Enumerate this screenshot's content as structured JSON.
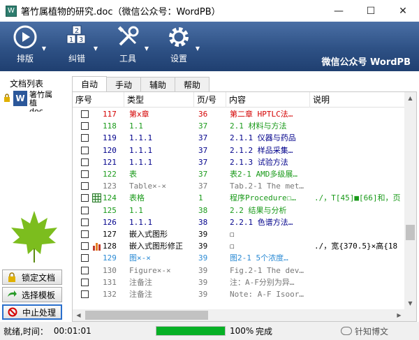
{
  "window": {
    "title": "箸竹属植物的研究.doc（微信公众号：WordPB）",
    "minimize": "—",
    "maximize": "☐",
    "close": "✕"
  },
  "toolbar": {
    "items": [
      {
        "label": "排版",
        "icon": "play-icon"
      },
      {
        "label": "纠错",
        "icon": "blocks-icon"
      },
      {
        "label": "工具",
        "icon": "tools-icon"
      },
      {
        "label": "设置",
        "icon": "gear-icon"
      }
    ],
    "brand": "微信公众号 WordPB"
  },
  "sidebar": {
    "title": "文档列表",
    "doc_name": "箸竹属植物的研究.doc",
    "doc_name_line1": "箸竹属植",
    "doc_name_line2": "doc",
    "buttons": [
      {
        "label": "锁定文档",
        "icon": "lock-icon"
      },
      {
        "label": "选择模板",
        "icon": "arrow-icon"
      },
      {
        "label": "中止处理",
        "icon": "stop-icon"
      }
    ]
  },
  "tabs": [
    "自动",
    "手动",
    "辅助",
    "帮助"
  ],
  "table": {
    "headers": [
      "序号",
      "类型",
      "页/号",
      "内容",
      "说明"
    ],
    "rows": [
      {
        "num": "117",
        "type": "第x章",
        "page": "36",
        "content": "第二章  HPTLC法…",
        "note": "",
        "color": "#d40000",
        "icon": ""
      },
      {
        "num": "118",
        "type": "1.1",
        "page": "37",
        "content": "2.1 材料与方法",
        "note": "",
        "color": "#1a9a1a",
        "icon": ""
      },
      {
        "num": "119",
        "type": "1.1.1",
        "page": "37",
        "content": "2.1.1 仪器与药品",
        "note": "",
        "color": "#00008b",
        "icon": ""
      },
      {
        "num": "120",
        "type": "1.1.1",
        "page": "37",
        "content": "2.1.2 样品采集…",
        "note": "",
        "color": "#00008b",
        "icon": ""
      },
      {
        "num": "121",
        "type": "1.1.1",
        "page": "37",
        "content": "2.1.3 试验方法",
        "note": "",
        "color": "#00008b",
        "icon": ""
      },
      {
        "num": "122",
        "type": "表",
        "page": "37",
        "content": "表2-1 AMD多级展…",
        "note": "",
        "color": "#1a9a1a",
        "icon": ""
      },
      {
        "num": "123",
        "type": "Table×-×",
        "page": "37",
        "content": "Tab.2-1 The met…",
        "note": "",
        "color": "#777777",
        "icon": ""
      },
      {
        "num": "124",
        "type": "表格",
        "page": "1",
        "content": "程序Procedure☐…",
        "note": "./，T[45]■[66]和，页",
        "color": "#1a9a1a",
        "icon": "table"
      },
      {
        "num": "125",
        "type": "1.1",
        "page": "38",
        "content": "2.2 结果与分析",
        "note": "",
        "color": "#1a9a1a",
        "icon": ""
      },
      {
        "num": "126",
        "type": "1.1.1",
        "page": "38",
        "content": "2.2.1 色谱方法…",
        "note": "",
        "color": "#00008b",
        "icon": ""
      },
      {
        "num": "127",
        "type": "嵌入式图形",
        "page": "39",
        "content": "☐",
        "note": "",
        "color": "#000000",
        "icon": ""
      },
      {
        "num": "128",
        "type": "嵌入式图形修正",
        "page": "39",
        "content": "☐",
        "note": "./，宽{370.5}×高{18",
        "color": "#000000",
        "icon": "chart"
      },
      {
        "num": "129",
        "type": "图×-×",
        "page": "39",
        "content": "图2-1  5个浓度…",
        "note": "",
        "color": "#2a8ad4",
        "icon": ""
      },
      {
        "num": "130",
        "type": "Figure×-×",
        "page": "39",
        "content": "Fig.2-1 The dev…",
        "note": "",
        "color": "#777777",
        "icon": ""
      },
      {
        "num": "131",
        "type": "注备注",
        "page": "39",
        "content": "注：A-F分别为异…",
        "note": "",
        "color": "#777777",
        "icon": ""
      },
      {
        "num": "132",
        "type": "注备注",
        "page": "39",
        "content": "Note: A-F Isoor…",
        "note": "",
        "color": "#777777",
        "icon": ""
      }
    ]
  },
  "status": {
    "text": "就绪,时间：",
    "time": "00:01:01",
    "progress": 100,
    "percent": "100%",
    "done": "完成",
    "watermark": "针知博文"
  }
}
